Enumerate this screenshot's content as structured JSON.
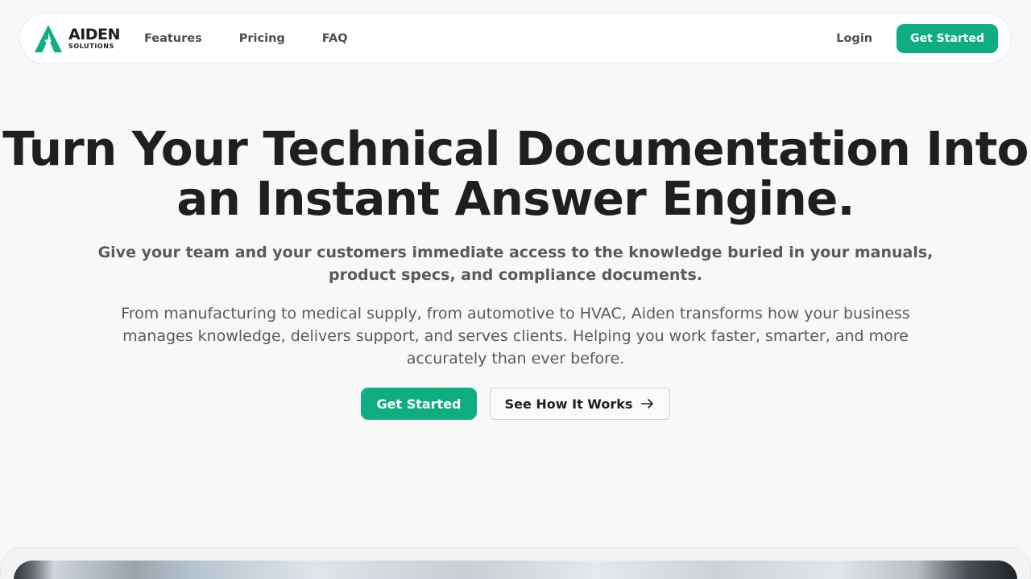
{
  "brand": {
    "name": "AIDEN",
    "sub": "SOLUTIONS",
    "accent_color": "#0fae82",
    "logo_icon": "aiden-logo-icon"
  },
  "nav": {
    "links": [
      "Features",
      "Pricing",
      "FAQ"
    ],
    "login": "Login",
    "cta": "Get Started"
  },
  "hero": {
    "title_line1": "Turn Your Technical Documentation Into",
    "title_line2": "an Instant Answer Engine.",
    "subtitle": "Give your team and your customers immediate access to the knowledge buried in your manuals, product specs, and compliance documents.",
    "description": "From manufacturing to medical supply, from automotive to HVAC, Aiden transforms how your business manages knowledge, delivers support, and serves clients. Helping you work faster, smarter, and more accurately than ever before.",
    "primary_cta": "Get Started",
    "secondary_cta": "See How It Works",
    "secondary_icon": "arrow-right-icon"
  }
}
